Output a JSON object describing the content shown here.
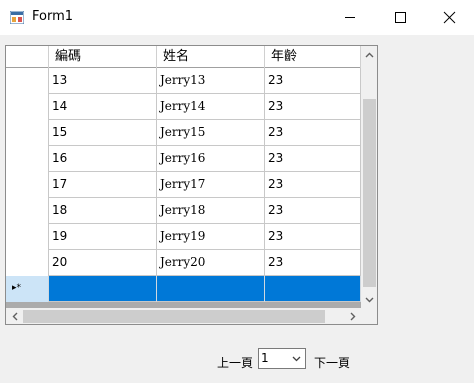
{
  "window": {
    "title": "Form1",
    "icon": "winform-app-icon",
    "controls": [
      "minimize-icon",
      "maximize-icon",
      "close-icon"
    ]
  },
  "grid": {
    "columns": [
      "編碼",
      "姓名",
      "年齡"
    ],
    "rows": [
      [
        "13",
        "Jerry13",
        "23"
      ],
      [
        "14",
        "Jerry14",
        "23"
      ],
      [
        "15",
        "Jerry15",
        "23"
      ],
      [
        "16",
        "Jerry16",
        "23"
      ],
      [
        "17",
        "Jerry17",
        "23"
      ],
      [
        "18",
        "Jerry18",
        "23"
      ],
      [
        "19",
        "Jerry19",
        "23"
      ],
      [
        "20",
        "Jerry20",
        "23"
      ]
    ],
    "new_row_marker": "▸*",
    "selection_color": "#0078d7"
  },
  "pager": {
    "prev_label": "上一頁",
    "page_value": "1",
    "next_label": "下一頁"
  }
}
